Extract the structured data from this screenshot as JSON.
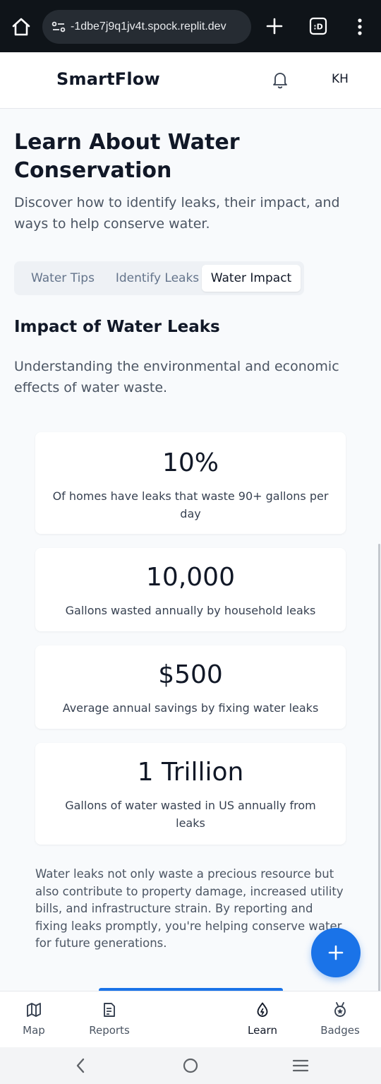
{
  "browser": {
    "url": "-1dbe7j9q1jv4t.spock.replit.dev",
    "tab_count_label": ":D"
  },
  "header": {
    "brand": "SmartFlow",
    "avatar_initials": "KH"
  },
  "page": {
    "title": "Learn About Water Conservation",
    "subtitle": "Discover how to identify leaks, their impact, and ways to help conserve water."
  },
  "tabs": [
    {
      "label": "Water Tips",
      "active": false
    },
    {
      "label": "Identify Leaks",
      "active": false
    },
    {
      "label": "Water Impact",
      "active": true
    }
  ],
  "section": {
    "title": "Impact of Water Leaks",
    "description": "Understanding the environmental and economic effects of water waste."
  },
  "stats": [
    {
      "value": "10%",
      "label": "Of homes have leaks that waste 90+ gallons per day"
    },
    {
      "value": "10,000",
      "label": "Gallons wasted annually by household leaks"
    },
    {
      "value": "$500",
      "label": "Average annual savings by fixing water leaks"
    },
    {
      "value": "1 Trillion",
      "label": "Gallons of water wasted in US annually from leaks"
    }
  ],
  "footnote": "Water leaks not only waste a precious resource but also contribute to property damage, increased utility bills, and infrastructure strain. By reporting and fixing leaks promptly, you're helping conserve water for future generations.",
  "bottom_nav": [
    {
      "label": "Map",
      "icon": "map-icon",
      "active": false
    },
    {
      "label": "Reports",
      "icon": "reports-icon",
      "active": false
    },
    {
      "label": "Learn",
      "icon": "learn-droplet-icon",
      "active": true
    },
    {
      "label": "Badges",
      "icon": "badge-medal-icon",
      "active": false
    }
  ],
  "colors": {
    "accent": "#1a73e8",
    "background": "#f8fafc",
    "browser_bar": "#0f1419"
  }
}
